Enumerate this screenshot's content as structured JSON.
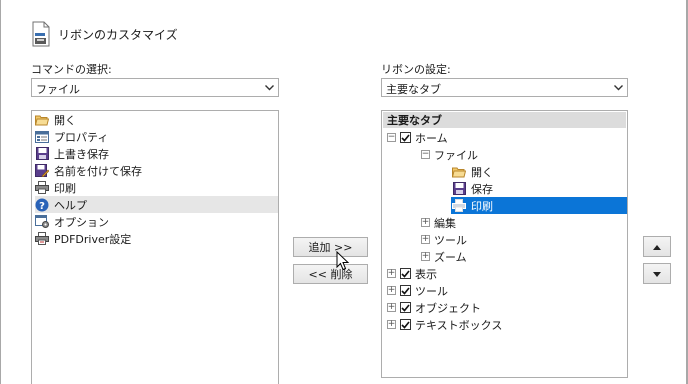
{
  "header": {
    "title": "リボンのカスタマイズ",
    "icon": "customize-ribbon-icon"
  },
  "left": {
    "label": "コマンドの選択:",
    "dropdown_value": "ファイル",
    "items": [
      {
        "label": "開く",
        "icon": "open-folder-icon"
      },
      {
        "label": "プロパティ",
        "icon": "properties-icon"
      },
      {
        "label": "上書き保存",
        "icon": "save-icon"
      },
      {
        "label": "名前を付けて保存",
        "icon": "save-as-icon"
      },
      {
        "label": "印刷",
        "icon": "print-icon"
      },
      {
        "label": "ヘルプ",
        "icon": "help-icon"
      },
      {
        "label": "オプション",
        "icon": "options-icon"
      },
      {
        "label": "PDFDriver設定",
        "icon": "pdf-driver-icon"
      }
    ],
    "selected_index": 5
  },
  "middle": {
    "add_label": "追加 >>",
    "remove_label": "<< 削除"
  },
  "right": {
    "label": "リボンの設定:",
    "dropdown_value": "主要なタブ",
    "tree_header": "主要なタブ",
    "tree": [
      {
        "label": "ホーム",
        "expander": "minus",
        "checkbox": true
      },
      {
        "label": "ファイル",
        "expander": "minus"
      },
      {
        "label": "開く",
        "icon": "open-folder-icon"
      },
      {
        "label": "保存",
        "icon": "save-icon"
      },
      {
        "label": "印刷",
        "icon": "print-icon",
        "selected": true
      },
      {
        "label": "編集",
        "expander": "plus"
      },
      {
        "label": "ツール",
        "expander": "plus"
      },
      {
        "label": "ズーム",
        "expander": "plus"
      },
      {
        "label": "表示",
        "expander": "plus",
        "checkbox": true
      },
      {
        "label": "ツール",
        "expander": "plus",
        "checkbox": true
      },
      {
        "label": "オブジェクト",
        "expander": "plus",
        "checkbox": true
      },
      {
        "label": "テキストボックス",
        "expander": "plus",
        "checkbox": true
      }
    ]
  },
  "side_buttons": {
    "up": "move-up-icon",
    "down": "move-down-icon"
  },
  "colors": {
    "selection": "#0b75d7",
    "hover": "#e6e6e6",
    "border": "#adadad"
  }
}
